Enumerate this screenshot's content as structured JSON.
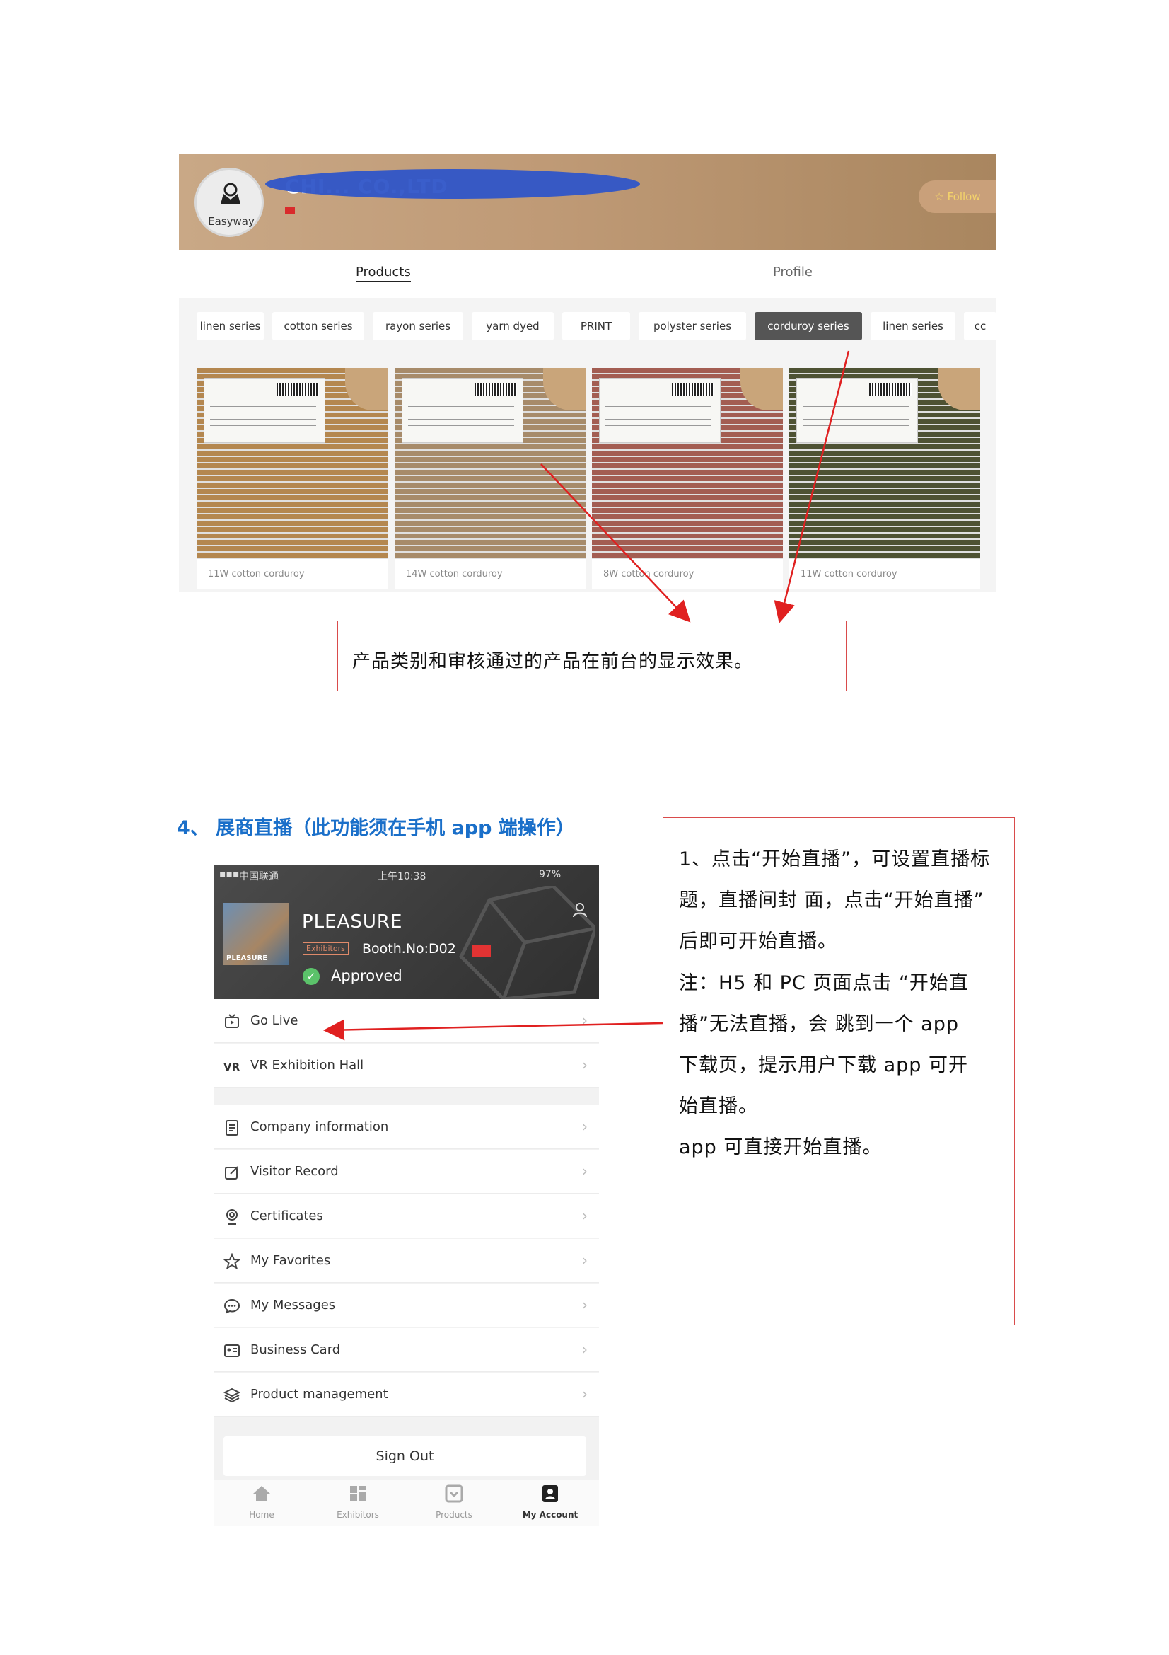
{
  "store": {
    "logo_text": "Easyway",
    "company_name": "CHI... CO.,LTD",
    "follow_label": "Follow",
    "tabs": [
      "Products",
      "Profile"
    ],
    "categories": [
      "linen series",
      "cotton series",
      "rayon series",
      "yarn dyed",
      "PRINT",
      "polyster series",
      "corduroy series",
      "linen series",
      "cc"
    ],
    "active_category": "corduroy series",
    "products": [
      {
        "name": "11W cotton corduroy",
        "color": "#b4874f"
      },
      {
        "name": "14W cotton corduroy",
        "color": "#a78b6a"
      },
      {
        "name": "8W cotton corduroy",
        "color": "#a35d52"
      },
      {
        "name": "11W cotton corduroy",
        "color": "#4e5233"
      }
    ]
  },
  "note1": "产品类别和审核通过的产品在前台的显示效果。",
  "section_heading": "4、 展商直播（此功能须在手机 app 端操作）",
  "phone": {
    "carrier": "中国联通",
    "time": "上午10:38",
    "battery": "97%",
    "exhibitor_name": "PLEASURE",
    "avatar_text": "PLEASURE",
    "badge": "Exhibitors",
    "booth": "Booth.No:D02",
    "status": "Approved",
    "menu": {
      "group1": [
        "Go Live",
        "VR Exhibition Hall"
      ],
      "group2": [
        "Company information",
        "Visitor Record",
        "Certificates",
        "My Favorites",
        "My Messages",
        "Business Card",
        "Product management"
      ]
    },
    "sign_out": "Sign Out",
    "nav": [
      "Home",
      "Exhibitors",
      "Products",
      "My Account"
    ]
  },
  "note2": [
    "1、点击“开始直播”，可设置直播标",
    "题，直播间封  面，点击“开始直播”",
    "后即可开始直播。",
    "注：H5  和  PC  页面点击 “开始直",
    "播”无法直播，会  跳到一个  app",
    "下载页，提示用户下载 app  可开",
    "始直播。",
    "app  可直接开始直播。"
  ],
  "colors": {
    "heading": "#1a6fc9",
    "annotation_red": "#d94b4b",
    "arrow_red": "#e02020"
  }
}
